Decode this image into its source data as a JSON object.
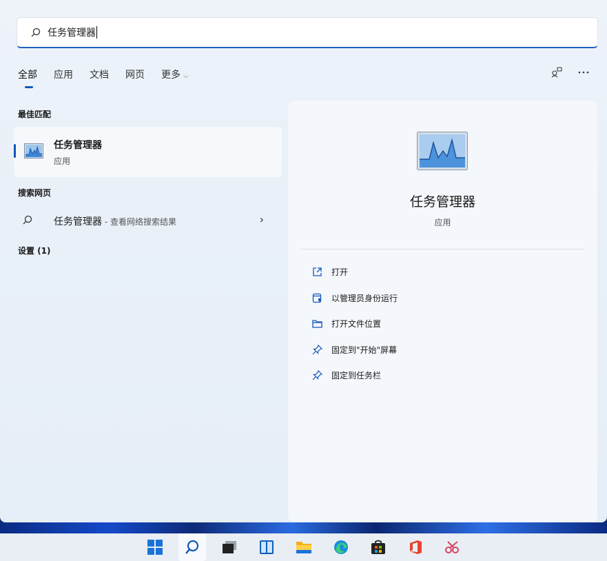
{
  "search": {
    "query": "任务管理器"
  },
  "tabs": [
    {
      "label": "全部"
    },
    {
      "label": "应用"
    },
    {
      "label": "文档"
    },
    {
      "label": "网页"
    },
    {
      "label": "更多"
    }
  ],
  "more_icon": "ellipsis-icon",
  "sections": {
    "best_match": "最佳匹配",
    "search_web": "搜索网页",
    "settings": "设置 (1)"
  },
  "best_match": {
    "name": "任务管理器",
    "type": "应用"
  },
  "web_result": {
    "query": "任务管理器",
    "suffix": " - 查看网络搜索结果"
  },
  "detail": {
    "name": "任务管理器",
    "type": "应用",
    "actions": [
      {
        "label": "打开",
        "icon": "open-icon"
      },
      {
        "label": "以管理员身份运行",
        "icon": "shield-icon"
      },
      {
        "label": "打开文件位置",
        "icon": "folder-icon"
      },
      {
        "label": "固定到\"开始\"屏幕",
        "icon": "pin-icon"
      },
      {
        "label": "固定到任务栏",
        "icon": "pin-icon"
      }
    ]
  },
  "colors": {
    "accent": "#1257b8",
    "panel": "#eef3fa",
    "card": "#f4f7fb"
  },
  "taskbar": [
    "windows-start-icon",
    "search-icon",
    "task-view-icon",
    "widgets-icon",
    "file-explorer-icon",
    "edge-icon",
    "store-icon",
    "office-icon",
    "snipping-tool-icon"
  ]
}
